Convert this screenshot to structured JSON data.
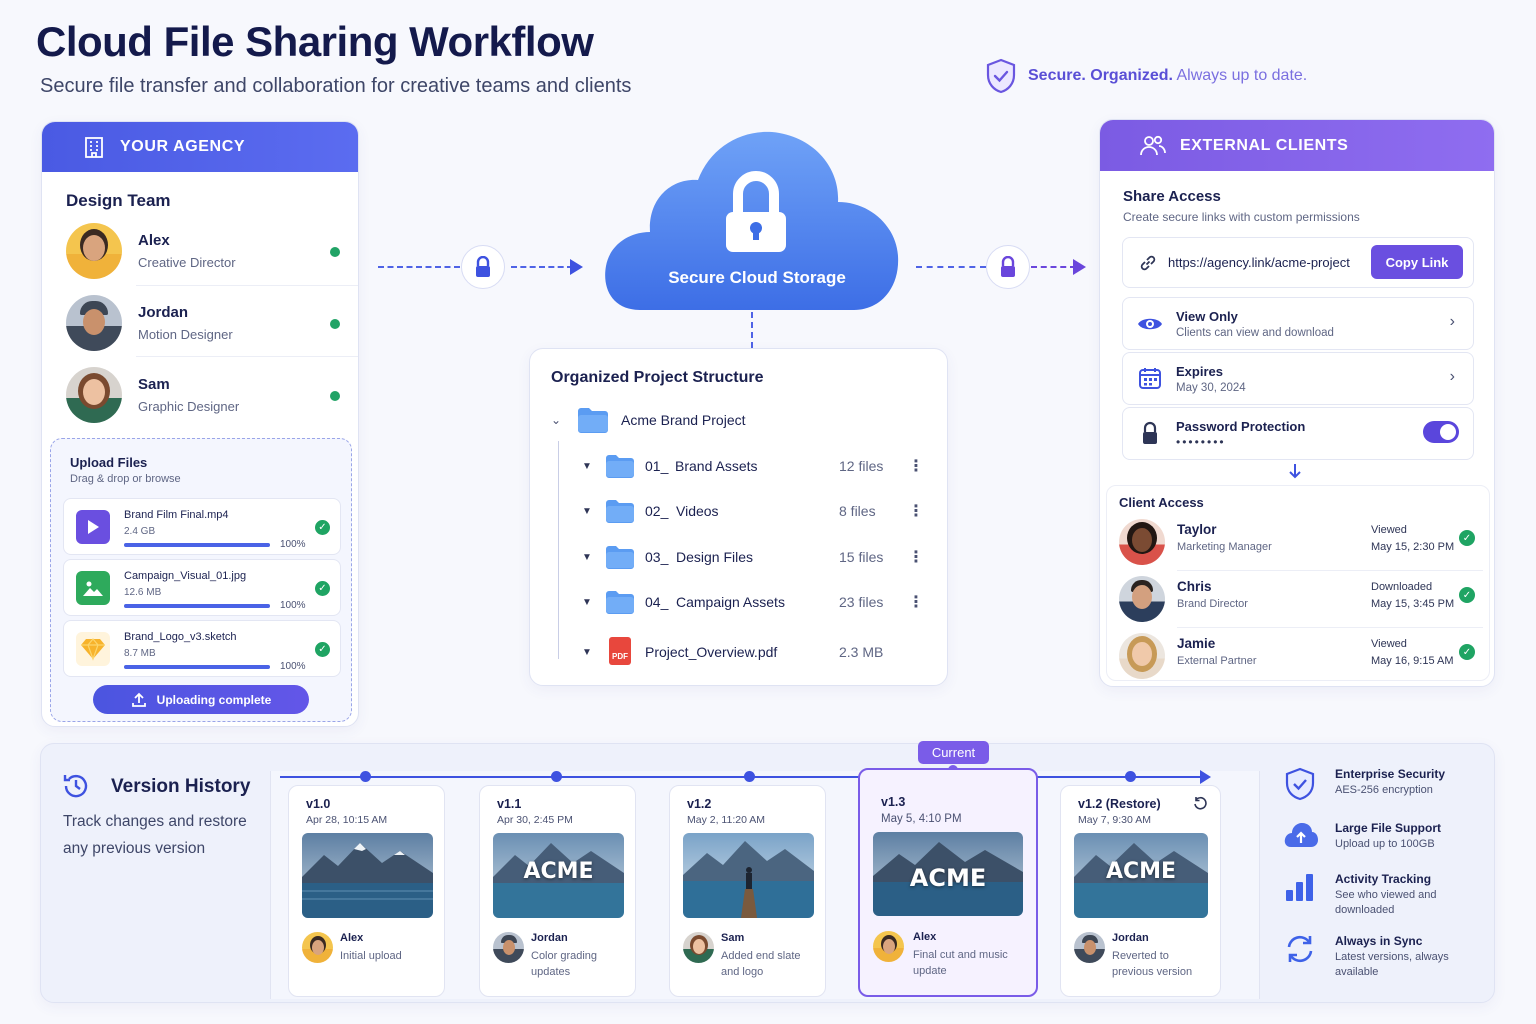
{
  "header": {
    "title": "Cloud File Sharing Workflow",
    "subtitle": "Secure file transfer and collaboration for creative teams and clients",
    "tagline_bold": "Secure. Organized.",
    "tagline_rest": "Always up to date."
  },
  "agency": {
    "header": "YOUR AGENCY",
    "team_title": "Design Team",
    "members": [
      {
        "name": "Alex",
        "role": "Creative Director"
      },
      {
        "name": "Jordan",
        "role": "Motion Designer"
      },
      {
        "name": "Sam",
        "role": "Graphic Designer"
      }
    ],
    "upload": {
      "title": "Upload Files",
      "subtitle": "Drag & drop or browse",
      "files": [
        {
          "name": "Brand Film Final.mp4",
          "size": "2.4 GB",
          "progress": "100%",
          "progress_value": 1.0
        },
        {
          "name": "Campaign_Visual_01.jpg",
          "size": "12.6 MB",
          "progress": "100%",
          "progress_value": 1.0
        },
        {
          "name": "Brand_Logo_v3.sketch",
          "size": "8.7 MB",
          "progress": "100%",
          "progress_value": 1.0
        }
      ],
      "button": "Uploading complete"
    }
  },
  "cloud": {
    "label": "Secure Cloud Storage"
  },
  "structure": {
    "title": "Organized Project Structure",
    "root": "Acme Brand Project",
    "items": [
      {
        "prefix": "01_",
        "name": "Brand Assets",
        "count": "12 files"
      },
      {
        "prefix": "02_",
        "name": "Videos",
        "count": "8 files"
      },
      {
        "prefix": "03_",
        "name": "Design Files",
        "count": "15 files"
      },
      {
        "prefix": "04_",
        "name": "Campaign Assets",
        "count": "23 files"
      }
    ],
    "file": {
      "name": "Project_Overview.pdf",
      "size": "2.3 MB",
      "badge": "PDF"
    }
  },
  "clients": {
    "header": "EXTERNAL CLIENTS",
    "share_title": "Share Access",
    "share_sub": "Create secure links with custom permissions",
    "link": "https://agency.link/acme-project",
    "copy_label": "Copy Link",
    "view_title": "View Only",
    "view_sub": "Clients can view and download",
    "expires_title": "Expires",
    "expires_date": "May 30, 2024",
    "password_title": "Password Protection",
    "password_mask": "••••••••",
    "access_title": "Client Access",
    "list": [
      {
        "name": "Taylor",
        "role": "Marketing Manager",
        "action": "Viewed",
        "time": "May 15, 2:30 PM"
      },
      {
        "name": "Chris",
        "role": "Brand Director",
        "action": "Downloaded",
        "time": "May 15, 3:45 PM"
      },
      {
        "name": "Jamie",
        "role": "External Partner",
        "action": "Viewed",
        "time": "May 16, 9:15 AM"
      }
    ]
  },
  "versions": {
    "title": "Version History",
    "desc": "Track changes and restore any previous version",
    "current_badge": "Current",
    "items": [
      {
        "label": "v1.0",
        "date": "Apr 28, 10:15 AM",
        "author": "Alex",
        "note": "Initial upload",
        "thumb_text": ""
      },
      {
        "label": "v1.1",
        "date": "Apr 30, 2:45 PM",
        "author": "Jordan",
        "note": "Color grading updates",
        "thumb_text": "ACME"
      },
      {
        "label": "v1.2",
        "date": "May 2, 11:20 AM",
        "author": "Sam",
        "note": "Added end slate and logo",
        "thumb_text": ""
      },
      {
        "label": "v1.3",
        "date": "May 5, 4:10 PM",
        "author": "Alex",
        "note": "Final cut and music update",
        "thumb_text": "ACME"
      },
      {
        "label": "v1.2 (Restore)",
        "date": "May 7, 9:30 AM",
        "author": "Jordan",
        "note": "Reverted to previous version",
        "thumb_text": "ACME"
      }
    ]
  },
  "features": [
    {
      "title": "Enterprise Security",
      "sub": "AES-256 encryption",
      "icon": "shield-icon"
    },
    {
      "title": "Large File Support",
      "sub": "Upload up to 100GB",
      "icon": "cloud-upload-icon"
    },
    {
      "title": "Activity Tracking",
      "sub": "See who viewed and downloaded",
      "icon": "bar-chart-icon"
    },
    {
      "title": "Always in Sync",
      "sub": "Latest versions, always available",
      "icon": "sync-icon"
    }
  ],
  "colors": {
    "primary": "#4a5ae3",
    "accent": "#7b5be3",
    "success": "#21a366",
    "cloud": "#4f86f0"
  }
}
